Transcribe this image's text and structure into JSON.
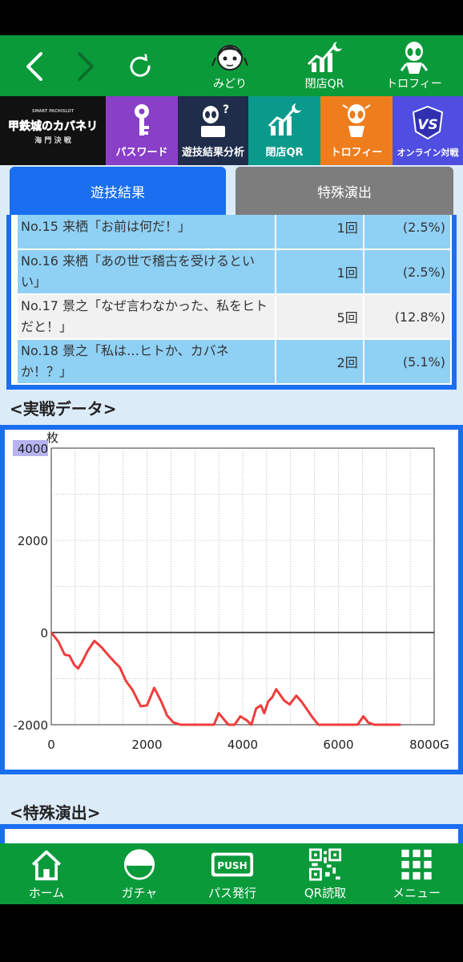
{
  "top_nav": {
    "midori_label": "みどり",
    "closing_qr_label": "閉店QR",
    "trophy_label": "トロフィー"
  },
  "tiles": {
    "password": "パスワード",
    "analysis": "遊技結果分析",
    "closing_qr": "閉店QR",
    "trophy": "トロフィー",
    "online": "オンライン対戦",
    "online_badge": "VS",
    "logo_line1": "甲鉄城のカバネリ",
    "logo_line2": "海 門 決 戦"
  },
  "tabs": {
    "result": "遊技結果",
    "special": "特殊演出"
  },
  "result_rows": [
    {
      "name": "No.15 来栖「お前は何だ！」",
      "count": "1回",
      "pct": "(2.5%)"
    },
    {
      "name": "No.16 来栖「あの世で稽古を受けるといい」",
      "count": "1回",
      "pct": "(2.5%)"
    },
    {
      "name": "No.17 景之「なぜ言わなかった、私をヒトだと！」",
      "count": "5回",
      "pct": "(12.8%)"
    },
    {
      "name": "No.18 景之「私は…ヒトか、カバネか！？」",
      "count": "2回",
      "pct": "(5.1%)"
    }
  ],
  "sections": {
    "real_data": "<実戦データ>",
    "special_effects": "<特殊演出>"
  },
  "chart_data": {
    "type": "line",
    "ylabel": "枚",
    "xlabel": "",
    "x_unit_label": "8000G",
    "xlim": [
      0,
      8000
    ],
    "ylim": [
      -2000,
      4000
    ],
    "x_ticks": [
      "0",
      "2000",
      "4000",
      "6000",
      "8000G"
    ],
    "y_ticks": [
      "4000",
      "2000",
      "0",
      "-2000"
    ],
    "grid": true,
    "series": [
      {
        "color": "#f03c3c",
        "x": [
          0,
          150,
          280,
          380,
          480,
          560,
          640,
          760,
          900,
          1050,
          1200,
          1320,
          1430,
          1560,
          1700,
          1870,
          2000,
          2150,
          2300,
          2420,
          2550,
          2700,
          2850,
          3000,
          3200,
          3400,
          3500,
          3580,
          3700,
          3830,
          3950,
          4080,
          4180,
          4280,
          4380,
          4450,
          4530,
          4620,
          4700,
          4780,
          4870,
          4980,
          5120,
          5230,
          5350,
          5450,
          5580,
          5700,
          5850,
          6000,
          6200,
          6400,
          6520,
          6620,
          6750,
          6900,
          7100,
          7300
        ],
        "y": [
          0,
          -200,
          -480,
          -500,
          -700,
          -780,
          -650,
          -400,
          -180,
          -320,
          -500,
          -640,
          -750,
          -1050,
          -1250,
          -1600,
          -1580,
          -1200,
          -1500,
          -1800,
          -1950,
          -2000,
          -2000,
          -2000,
          -2000,
          -2000,
          -1750,
          -1850,
          -2000,
          -2000,
          -1820,
          -1900,
          -2000,
          -1650,
          -1580,
          -1750,
          -1500,
          -1400,
          -1230,
          -1350,
          -1480,
          -1560,
          -1370,
          -1500,
          -1680,
          -1830,
          -2000,
          -2000,
          -2000,
          -2000,
          -2000,
          -2000,
          -1820,
          -1950,
          -2000,
          -2000,
          -2000,
          -2000
        ]
      }
    ]
  },
  "bottom_nav": {
    "home": "ホーム",
    "gacha": "ガチャ",
    "pass": "パス発行",
    "push_text": "PUSH",
    "qr": "QR読取",
    "menu": "メニュー"
  },
  "colors": {
    "green": "#0a9a3a",
    "blue": "#1a6ef0",
    "row_blue": "#8fd0f5",
    "line": "#f03c3c"
  }
}
